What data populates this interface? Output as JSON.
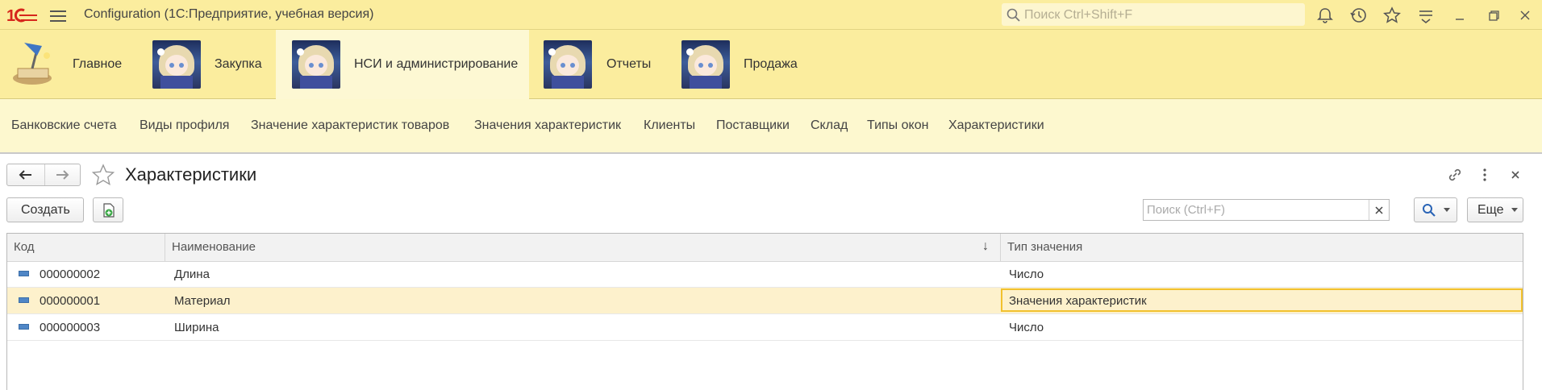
{
  "window": {
    "title": "Configuration  (1С:Предприятие, учебная версия)",
    "search_placeholder": "Поиск Ctrl+Shift+F",
    "icons": [
      "bell-icon",
      "history-icon",
      "favorites-star-icon",
      "menu-lines-icon",
      "minimize-icon",
      "restore-icon",
      "close-icon"
    ]
  },
  "sections": [
    {
      "label": "Главное",
      "icon": "desk-lamp-icon",
      "active": false
    },
    {
      "label": "Закупка",
      "icon": "anime-avatar",
      "active": false
    },
    {
      "label": "НСИ и администрирование",
      "icon": "anime-avatar",
      "active": true
    },
    {
      "label": "Отчеты",
      "icon": "anime-avatar",
      "active": false
    },
    {
      "label": "Продажа",
      "icon": "anime-avatar",
      "active": false
    }
  ],
  "subnav": [
    "Банковские счета",
    "Виды профиля",
    "Значение характеристик товаров",
    "Значения характеристик",
    "Клиенты",
    "Поставщики",
    "Склад",
    "Типы окон",
    "Характеристики"
  ],
  "form": {
    "title": "Характеристики",
    "create_label": "Создать",
    "search_placeholder": "Поиск (Ctrl+F)",
    "more_label": "Еще"
  },
  "table": {
    "columns": [
      "Код",
      "Наименование",
      "Тип значения"
    ],
    "sort_indicator": "↓",
    "rows": [
      {
        "code": "000000002",
        "name": "Длина",
        "type": "Число",
        "selected": false
      },
      {
        "code": "000000001",
        "name": "Материал",
        "type": "Значения характеристик",
        "selected": true
      },
      {
        "code": "000000003",
        "name": "Ширина",
        "type": "Число",
        "selected": false
      }
    ]
  },
  "colors": {
    "header_yellow": "#fbed9e",
    "subnav_yellow": "#fdf8cf",
    "selection": "#fdf1cc",
    "focus_border": "#f2c12e",
    "logo_red": "#d6261c"
  }
}
